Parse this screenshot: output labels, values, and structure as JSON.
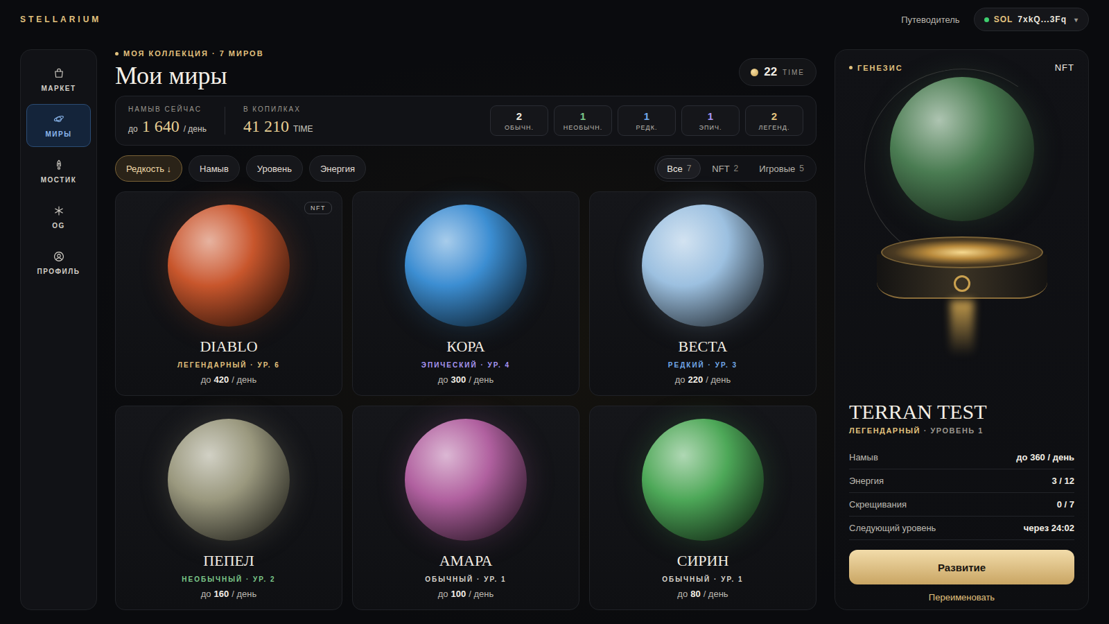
{
  "logo": "STELLARIUM",
  "topbar": {
    "guide": "Путеводитель",
    "wallet": {
      "chain": "SOL",
      "address": "7xkQ...3Fq",
      "caret": "▾",
      "connected": true
    }
  },
  "sidebar": {
    "items": [
      {
        "label": "МАРКЕТ",
        "selected": false
      },
      {
        "label": "МИРЫ",
        "selected": true
      },
      {
        "label": "МОСТИК",
        "selected": false
      },
      {
        "label": "OG",
        "selected": false
      },
      {
        "label": "ПРОФИЛЬ",
        "selected": false
      }
    ]
  },
  "header": {
    "eyebrow": "МОЯ КОЛЛЕКЦИЯ · 7 МИРОВ",
    "title": "Мои миры",
    "balance": {
      "amount": "22",
      "unit": "TIME"
    }
  },
  "stats": {
    "yield": {
      "label": "НАМЫВ СЕЙЧАС",
      "prefix": "до",
      "value": "1 640",
      "suffix": "/ день"
    },
    "banks": {
      "label": "В КОПИЛКАХ",
      "value": "41 210",
      "unit": "TIME"
    },
    "rarities": [
      {
        "count": "2",
        "label": "ОБЫЧН.",
        "color": "#ece7de"
      },
      {
        "count": "1",
        "label": "НЕОБЫЧН.",
        "color": "#7cc98a"
      },
      {
        "count": "1",
        "label": "РЕДК.",
        "color": "#72a9ea"
      },
      {
        "count": "1",
        "label": "ЭПИЧ.",
        "color": "#a896f2"
      },
      {
        "count": "2",
        "label": "ЛЕГЕНД.",
        "color": "#e2c27e"
      }
    ]
  },
  "sort_chips": [
    {
      "label": "Редкость ↓",
      "selected": true
    },
    {
      "label": "Намыв",
      "selected": false
    },
    {
      "label": "Уровень",
      "selected": false
    },
    {
      "label": "Энергия",
      "selected": false
    }
  ],
  "filters": [
    {
      "label": "Все",
      "count": "7",
      "selected": true
    },
    {
      "label": "NFT",
      "count": "2",
      "selected": false
    },
    {
      "label": "Игровые",
      "count": "5",
      "selected": false
    }
  ],
  "nft_badge": "NFT",
  "worlds": [
    {
      "name": "DIABLO",
      "rarity": "ЛЕГЕНДАРНЫЙ · УР. 6",
      "yield_prefix": "до",
      "yield": "420",
      "yield_suffix": "/ день",
      "color": "#e2c27e",
      "planet": "#c8562c",
      "nft": true
    },
    {
      "name": "КОРА",
      "rarity": "ЭПИЧЕСКИЙ · УР. 4",
      "yield_prefix": "до",
      "yield": "300",
      "yield_suffix": "/ день",
      "color": "#a896f2",
      "planet": "#3c8ed2",
      "nft": false
    },
    {
      "name": "ВЕСТА",
      "rarity": "РЕДКИЙ · УР. 3",
      "yield_prefix": "до",
      "yield": "220",
      "yield_suffix": "/ день",
      "color": "#72a9ea",
      "planet": "#9cc0e0",
      "nft": false
    },
    {
      "name": "ПЕПЕЛ",
      "rarity": "НЕОБЫЧНЫЙ · УР. 2",
      "yield_prefix": "до",
      "yield": "160",
      "yield_suffix": "/ день",
      "color": "#7cc98a",
      "planet": "#9a987e",
      "nft": false
    },
    {
      "name": "АМАРА",
      "rarity": "ОБЫЧНЫЙ · УР. 1",
      "yield_prefix": "до",
      "yield": "100",
      "yield_suffix": "/ день",
      "color": "#d8d4cc",
      "planet": "#b0609f",
      "nft": false
    },
    {
      "name": "СИРИН",
      "rarity": "ОБЫЧНЫЙ · УР. 1",
      "yield_prefix": "до",
      "yield": "80",
      "yield_suffix": "/ день",
      "color": "#d8d4cc",
      "planet": "#4da858",
      "nft": false
    }
  ],
  "detail": {
    "eyebrow": "ГЕНЕЗИС",
    "badge": "NFT",
    "name": "TERRAN TEST",
    "rarity": "ЛЕГЕНДАРНЫЙ",
    "level": "· УРОВЕНЬ 1",
    "planet": "#4a7c52",
    "rows": [
      {
        "label": "Намыв",
        "value": "до 360 / день"
      },
      {
        "label": "Энергия",
        "value": "3 / 12"
      },
      {
        "label": "Скрещивания",
        "value": "0 / 7"
      },
      {
        "label": "Следующий уровень",
        "value": "через 24:02"
      }
    ],
    "primary_button": "Развитие",
    "link": "Переименовать"
  }
}
